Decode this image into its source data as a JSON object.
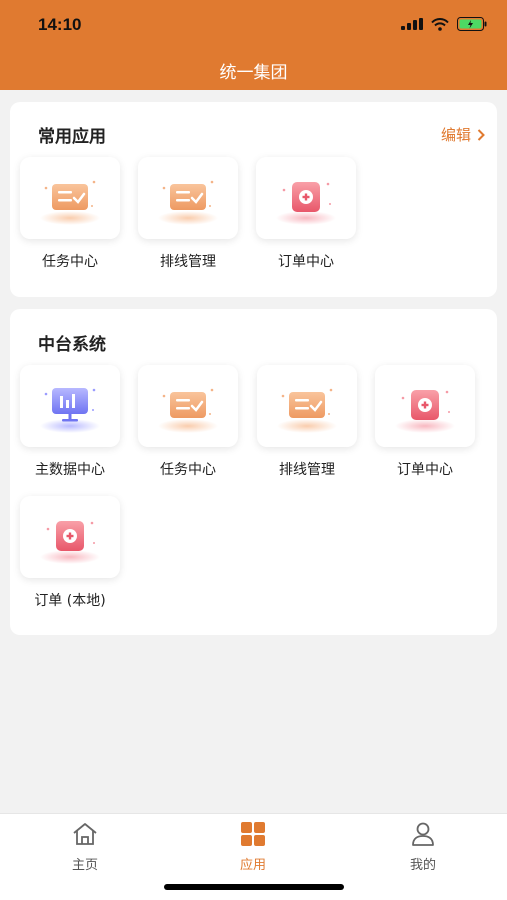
{
  "status_bar": {
    "time": "14:10"
  },
  "header": {
    "title": "统一集团"
  },
  "common_apps": {
    "title": "常用应用",
    "edit_label": "编辑",
    "items": [
      {
        "label": "任务中心",
        "icon": "task-card-icon"
      },
      {
        "label": "排线管理",
        "icon": "route-card-icon"
      },
      {
        "label": "订单中心",
        "icon": "order-box-icon"
      }
    ]
  },
  "platform": {
    "title": "中台系统",
    "items": [
      {
        "label": "主数据中心",
        "icon": "monitor-chart-icon"
      },
      {
        "label": "任务中心",
        "icon": "task-card-icon"
      },
      {
        "label": "排线管理",
        "icon": "route-card-icon"
      },
      {
        "label": "订单中心",
        "icon": "order-box-icon"
      },
      {
        "label": "订单 (本地)",
        "icon": "order-box-icon"
      }
    ]
  },
  "tabbar": {
    "items": [
      {
        "label": "主页",
        "icon": "home-icon"
      },
      {
        "label": "应用",
        "icon": "grid-icon",
        "active": true
      },
      {
        "label": "我的",
        "icon": "user-icon"
      }
    ]
  },
  "colors": {
    "accent": "#e07a30",
    "background": "#f2f2f2"
  }
}
